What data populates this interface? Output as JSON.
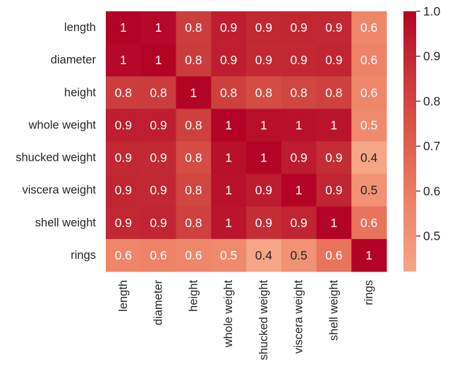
{
  "chart_data": {
    "type": "heatmap",
    "title": "",
    "xlabel": "",
    "ylabel": "",
    "row_labels": [
      "length",
      "diameter",
      "height",
      "whole weight",
      "shucked weight",
      "viscera weight",
      "shell weight",
      "rings"
    ],
    "col_labels": [
      "length",
      "diameter",
      "height",
      "whole weight",
      "shucked weight",
      "viscera weight",
      "shell weight",
      "rings"
    ],
    "values": [
      [
        1.0,
        0.987,
        0.828,
        0.925,
        0.898,
        0.903,
        0.898,
        0.557
      ],
      [
        0.987,
        1.0,
        0.834,
        0.925,
        0.893,
        0.9,
        0.905,
        0.575
      ],
      [
        0.828,
        0.834,
        1.0,
        0.819,
        0.775,
        0.798,
        0.817,
        0.557
      ],
      [
        0.925,
        0.925,
        0.819,
        1.0,
        0.969,
        0.966,
        0.955,
        0.54
      ],
      [
        0.898,
        0.893,
        0.775,
        0.969,
        1.0,
        0.932,
        0.883,
        0.421
      ],
      [
        0.903,
        0.9,
        0.798,
        0.966,
        0.932,
        1.0,
        0.908,
        0.504
      ],
      [
        0.898,
        0.905,
        0.817,
        0.955,
        0.883,
        0.908,
        1.0,
        0.628
      ],
      [
        0.557,
        0.575,
        0.557,
        0.54,
        0.421,
        0.504,
        0.628,
        1.0
      ]
    ],
    "annotations": [
      [
        "1",
        "1",
        "0.8",
        "0.9",
        "0.9",
        "0.9",
        "0.9",
        "0.6"
      ],
      [
        "1",
        "1",
        "0.8",
        "0.9",
        "0.9",
        "0.9",
        "0.9",
        "0.6"
      ],
      [
        "0.8",
        "0.8",
        "1",
        "0.8",
        "0.8",
        "0.8",
        "0.8",
        "0.6"
      ],
      [
        "0.9",
        "0.9",
        "0.8",
        "1",
        "1",
        "1",
        "1",
        "0.5"
      ],
      [
        "0.9",
        "0.9",
        "0.8",
        "1",
        "1",
        "0.9",
        "0.9",
        "0.4"
      ],
      [
        "0.9",
        "0.9",
        "0.8",
        "1",
        "0.9",
        "1",
        "0.9",
        "0.5"
      ],
      [
        "0.9",
        "0.9",
        "0.8",
        "1",
        "0.9",
        "0.9",
        "1",
        "0.6"
      ],
      [
        "0.6",
        "0.6",
        "0.6",
        "0.5",
        "0.4",
        "0.5",
        "0.6",
        "1"
      ]
    ],
    "colorbar": {
      "range": [
        0.421,
        1.0
      ],
      "ticks": [
        "0.5",
        "0.6",
        "0.7",
        "0.8",
        "0.9",
        "1.0"
      ],
      "tick_values": [
        0.5,
        0.6,
        0.7,
        0.8,
        0.9,
        1.0
      ],
      "placement": "right"
    },
    "colormap_stops": [
      {
        "v": 0.0,
        "color": "#f6a586"
      },
      {
        "v": 0.25,
        "color": "#ee8468"
      },
      {
        "v": 0.5,
        "color": "#dd5e4a"
      },
      {
        "v": 0.75,
        "color": "#c8363a"
      },
      {
        "v": 1.0,
        "color": "#b40426"
      }
    ],
    "annotation_colors": {
      "light": "#ffffff",
      "dark": "#262626"
    },
    "grid": false
  }
}
